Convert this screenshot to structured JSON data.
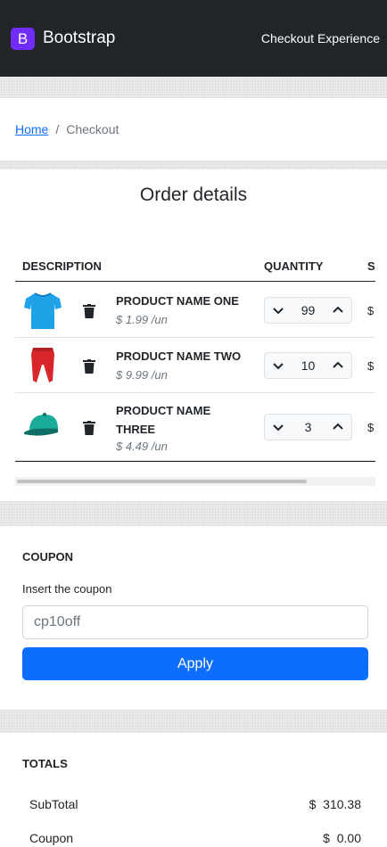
{
  "navbar": {
    "logo_letter": "B",
    "brand": "Bootstrap",
    "right_link": "Checkout Experience"
  },
  "breadcrumb": {
    "home": "Home",
    "separator": "/",
    "current": "Checkout"
  },
  "order": {
    "title": "Order details",
    "headers": {
      "description": "DESCRIPTION",
      "quantity": "QUANTITY",
      "subtotal_partial": "S"
    },
    "products": [
      {
        "name_line1": "PRODUCT NAME ONE",
        "name_line2": "",
        "price": "$ 1.99 /un",
        "quantity": "99",
        "subtotal_partial": "$",
        "image": "tshirt-image"
      },
      {
        "name_line1": "PRODUCT NAME TWO",
        "name_line2": "",
        "price": "$ 9.99 /un",
        "quantity": "10",
        "subtotal_partial": "$",
        "image": "pants-image"
      },
      {
        "name_line1": "PRODUCT NAME",
        "name_line2": "THREE",
        "price": "$ 4.49 /un",
        "quantity": "3",
        "subtotal_partial": "$",
        "image": "cap-image"
      }
    ]
  },
  "coupon": {
    "title": "COUPON",
    "label": "Insert the coupon",
    "placeholder": "cp10off",
    "apply": "Apply"
  },
  "totals": {
    "title": "TOTALS",
    "rows": [
      {
        "label": "SubTotal",
        "value": "$  310.38"
      },
      {
        "label": "Coupon",
        "value": "$  0.00"
      }
    ]
  },
  "colors": {
    "navbar_bg": "#212529",
    "brand_purple": "#712cf9",
    "primary": "#0d6efd",
    "tshirt": "#1fa2e8",
    "pants": "#d9262b",
    "cap": "#1aab9b"
  }
}
